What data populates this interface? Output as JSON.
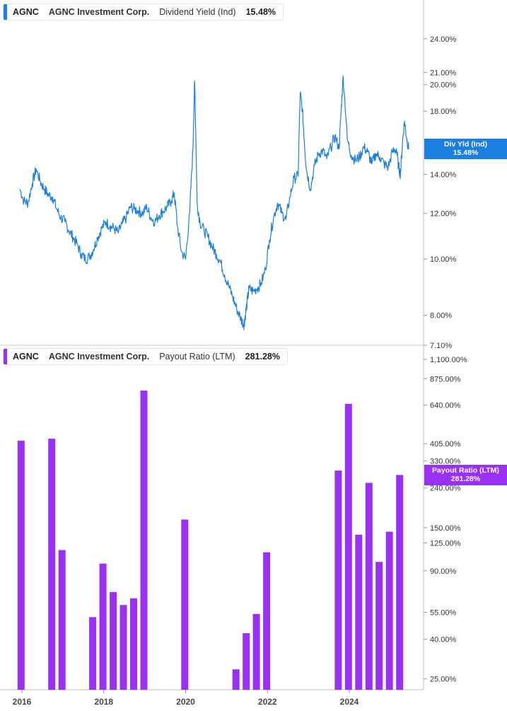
{
  "chart_data": [
    {
      "type": "line",
      "ticker": "AGNC",
      "company": "AGNC Investment Corp.",
      "metric": "Dividend Yield (Ind)",
      "current_value_label": "15.48%",
      "current_value": 15.48,
      "tag_label": "Div Yld (Ind)",
      "y_scale": "log",
      "ylim": [
        7.1,
        28
      ],
      "y_ticks": [
        "24.00%",
        "21.00%",
        "20.00%",
        "18.00%",
        "14.00%",
        "12.00%",
        "10.00%",
        "8.00%",
        "7.10%"
      ],
      "y_tick_values": [
        24,
        21,
        20,
        18,
        14,
        12,
        10,
        8,
        7.1
      ],
      "color": "#1a7fe0",
      "series": [
        {
          "x": [
            2015.95,
            2016.05,
            2016.15,
            2016.25,
            2016.35,
            2016.45,
            2016.55,
            2016.65,
            2016.75,
            2016.85,
            2016.95,
            2017.05,
            2017.15,
            2017.25,
            2017.35,
            2017.45,
            2017.55,
            2017.65,
            2017.75,
            2017.85,
            2017.95,
            2018.05,
            2018.15,
            2018.25,
            2018.35,
            2018.45,
            2018.55,
            2018.65,
            2018.75,
            2018.85,
            2018.95,
            2019.05,
            2019.15,
            2019.25,
            2019.35,
            2019.45,
            2019.55,
            2019.65,
            2019.72,
            2019.8,
            2019.9,
            2020.0,
            2020.1,
            2020.18,
            2020.22,
            2020.25,
            2020.28,
            2020.35,
            2020.45,
            2020.55,
            2020.65,
            2020.75,
            2020.85,
            2020.95,
            2021.05,
            2021.15,
            2021.25,
            2021.35,
            2021.42,
            2021.45,
            2021.5,
            2021.55,
            2021.65,
            2021.75,
            2021.85,
            2021.95,
            2022.05,
            2022.15,
            2022.25,
            2022.35,
            2022.45,
            2022.55,
            2022.65,
            2022.75,
            2022.8,
            2022.85,
            2022.9,
            2022.95,
            2023.05,
            2023.15,
            2023.25,
            2023.35,
            2023.45,
            2023.55,
            2023.65,
            2023.75,
            2023.8,
            2023.85,
            2023.95,
            2024.05,
            2024.15,
            2024.25,
            2024.35,
            2024.45,
            2024.55,
            2024.65,
            2024.75,
            2024.85,
            2024.95,
            2025.05,
            2025.15,
            2025.2,
            2025.25,
            2025.3,
            2025.35,
            2025.4,
            2025.45
          ],
          "values": [
            13.2,
            12.6,
            12.5,
            13.5,
            14.3,
            13.6,
            13.2,
            12.9,
            12.8,
            12.2,
            11.8,
            11.6,
            11.2,
            10.9,
            10.6,
            10.2,
            10.0,
            10.1,
            10.4,
            10.9,
            11.3,
            11.6,
            11.4,
            11.3,
            11.1,
            11.5,
            11.8,
            12.3,
            12.2,
            12.1,
            12.0,
            12.3,
            11.8,
            11.6,
            11.9,
            12.1,
            12.3,
            12.6,
            13.0,
            11.4,
            10.3,
            10.0,
            12.0,
            15.5,
            20.3,
            16.2,
            12.5,
            11.6,
            11.2,
            10.9,
            10.5,
            10.2,
            9.9,
            9.4,
            9.0,
            8.6,
            8.2,
            7.9,
            7.7,
            7.9,
            8.4,
            8.9,
            8.8,
            8.9,
            9.1,
            9.6,
            10.8,
            11.8,
            12.5,
            12.0,
            11.7,
            12.8,
            13.8,
            13.9,
            19.3,
            18.2,
            16.0,
            14.3,
            13.2,
            14.5,
            15.2,
            15.4,
            14.9,
            15.6,
            16.3,
            15.5,
            18.0,
            20.7,
            16.1,
            15.1,
            14.8,
            15.0,
            15.6,
            15.3,
            14.6,
            15.2,
            15.0,
            14.6,
            14.4,
            15.3,
            15.5,
            14.5,
            14.0,
            15.9,
            17.3,
            16.2,
            15.48
          ]
        }
      ]
    },
    {
      "type": "bar",
      "ticker": "AGNC",
      "company": "AGNC Investment Corp.",
      "metric": "Payout Ratio (LTM)",
      "current_value_label": "281.28%",
      "current_value": 281.28,
      "tag_label": "Payout Ratio (LTM)",
      "y_scale": "log",
      "ylim": [
        22,
        1300
      ],
      "y_ticks": [
        "1,100.00%",
        "875.00%",
        "640.00%",
        "405.00%",
        "330.00%",
        "240.00%",
        "150.00%",
        "125.00%",
        "90.00%",
        "55.00%",
        "40.00%",
        "25.00%"
      ],
      "y_tick_values": [
        1100,
        875,
        640,
        405,
        330,
        240,
        150,
        125,
        90,
        55,
        40,
        25
      ],
      "color": "#9b30f5",
      "x": [
        2015.98,
        2016.73,
        2016.98,
        2017.73,
        2017.98,
        2018.23,
        2018.48,
        2018.73,
        2018.98,
        2019.98,
        2021.23,
        2021.48,
        2021.73,
        2021.98,
        2023.73,
        2023.98,
        2024.23,
        2024.48,
        2024.73,
        2024.98,
        2025.23
      ],
      "values": [
        420,
        430,
        115,
        52,
        98,
        70,
        60,
        65,
        760,
        165,
        28,
        43,
        54,
        112,
        295,
        650,
        138,
        255,
        100,
        143,
        280
      ],
      "x_ticks": [
        "2016",
        "2018",
        "2020",
        "2022",
        "2024"
      ],
      "x_tick_values": [
        2016,
        2018,
        2020,
        2022,
        2024
      ]
    }
  ]
}
